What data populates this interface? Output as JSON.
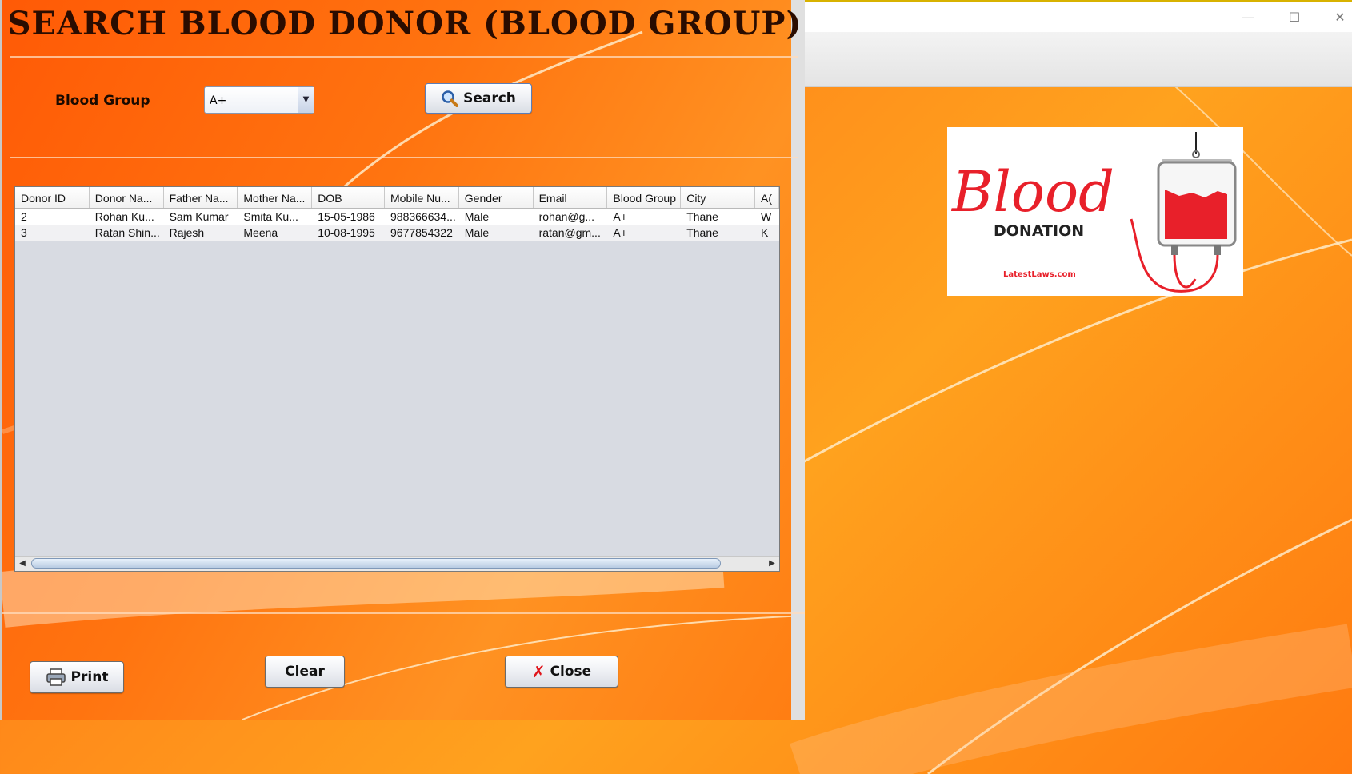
{
  "dialog": {
    "title": "SEARCH BLOOD DONOR (BLOOD GROUP)",
    "blood_group_label": "Blood Group",
    "blood_group_value": "A+",
    "search_label": "Search",
    "print_label": "Print",
    "clear_label": "Clear",
    "close_label": "Close"
  },
  "table": {
    "columns": [
      "Donor ID",
      "Donor Na...",
      "Father Na...",
      "Mother Na...",
      "DOB",
      "Mobile Nu...",
      "Gender",
      "Email",
      "Blood Group",
      "City",
      "A("
    ],
    "rows": [
      [
        "2",
        "Rohan Ku...",
        "Sam Kumar",
        "Smita Ku...",
        "15-05-1986",
        "988366634...",
        "Male",
        "rohan@g...",
        "A+",
        "Thane",
        "W"
      ],
      [
        "3",
        "Ratan Shin...",
        "Rajesh",
        "Meena",
        "10-08-1995",
        "9677854322",
        "Male",
        "ratan@gm...",
        "A+",
        "Thane",
        "K"
      ]
    ]
  },
  "background_window": {
    "minimize_glyph": "—",
    "maximize_glyph": "☐",
    "close_glyph": "✕",
    "logo": {
      "word": "Blood",
      "subtitle": "DONATION",
      "credit": "LatestLaws.com"
    }
  },
  "colors": {
    "accent_orange": "#ff7a10",
    "logo_red": "#e8202a"
  },
  "icons": {
    "search": "magnifier-icon",
    "print": "printer-icon",
    "close": "red-x-icon"
  }
}
